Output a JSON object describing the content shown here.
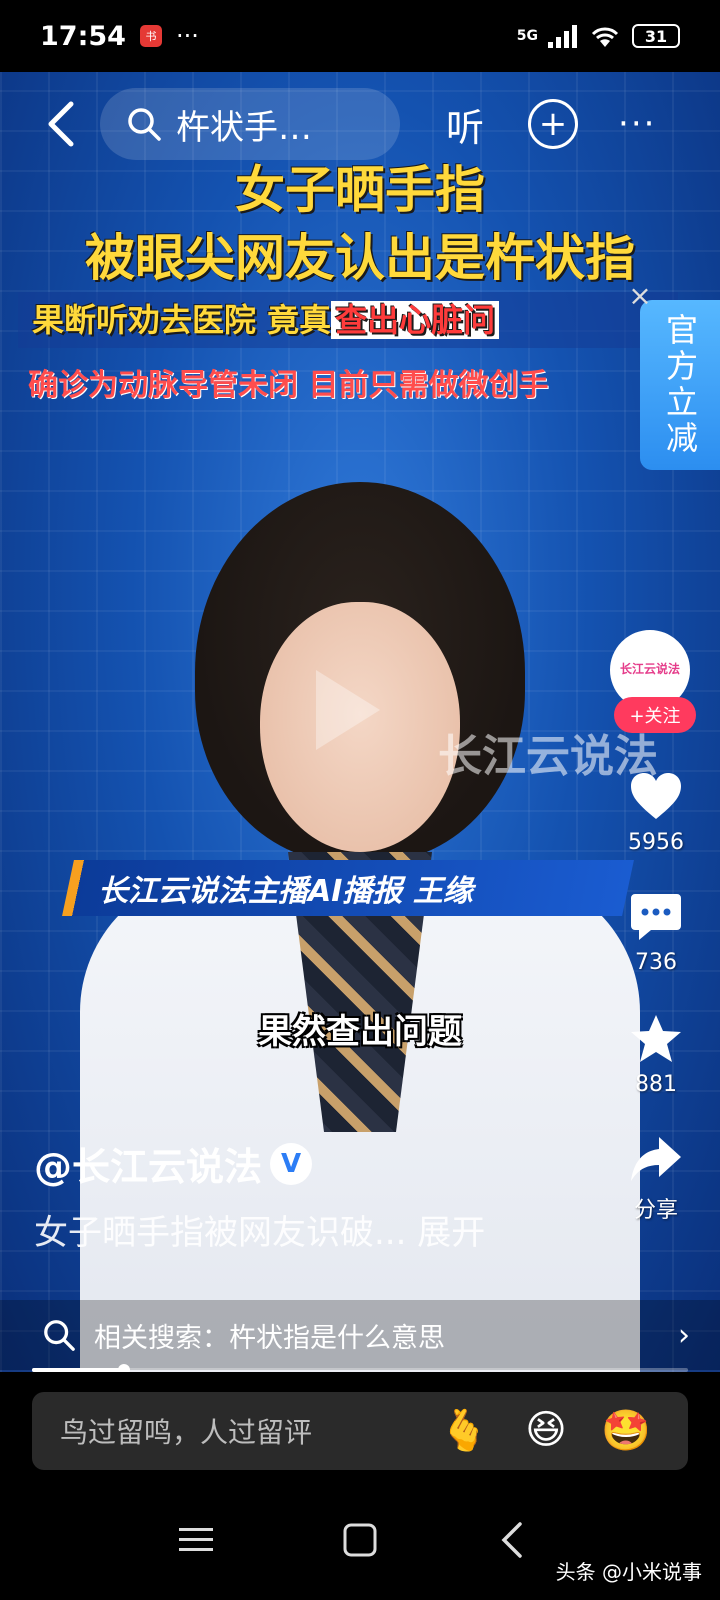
{
  "status_bar": {
    "time": "17:54",
    "app_badge": "小红书",
    "dots": "···",
    "network": "5G",
    "battery": "31"
  },
  "top_bar": {
    "search_query": "杵状手…",
    "listen_label": "听",
    "plus_label": "+",
    "more_label": "···"
  },
  "video": {
    "headline_line1": "女子晒手指",
    "headline_line2": "被眼尖网友认出是杵状指",
    "headline_line3_yellow": "果断听劝去医院 竟真",
    "headline_line3_red": "查出心脏问",
    "headline_line4": "确诊为动脉导管未闭 目前只需做微创手",
    "watermark": "长江云说法",
    "lower_third": "长江云说法主播AI播报  王缘",
    "subtitle": "果然查出问题"
  },
  "promo": {
    "label": "官方立减",
    "close": "×"
  },
  "side_actions": {
    "avatar_text": "长江云说法",
    "follow_label": "+关注",
    "likes": "5956",
    "comments": "736",
    "favorites": "881",
    "share_label": "分享"
  },
  "author": {
    "name": "@长江云说法",
    "verified": "V",
    "description": "女子晒手指被网友识破... 展开"
  },
  "related_search": {
    "text": "相关搜索：杵状指是什么意思",
    "arrow": "›"
  },
  "progress": {
    "fraction": 0.14
  },
  "comment_bar": {
    "placeholder": "鸟过留鸣，人过留评",
    "emoji_1": "🫰",
    "emoji_2": "😆",
    "emoji_3": "🤩"
  },
  "source_tag": "头条 @小米说事",
  "colors": {
    "headline_yellow": "#ffd93b",
    "headline_red": "#ff3b3b",
    "follow_red": "#ff3a5e",
    "promo_blue": "#2c8ef0",
    "caption_blue": "#0c3b99"
  }
}
